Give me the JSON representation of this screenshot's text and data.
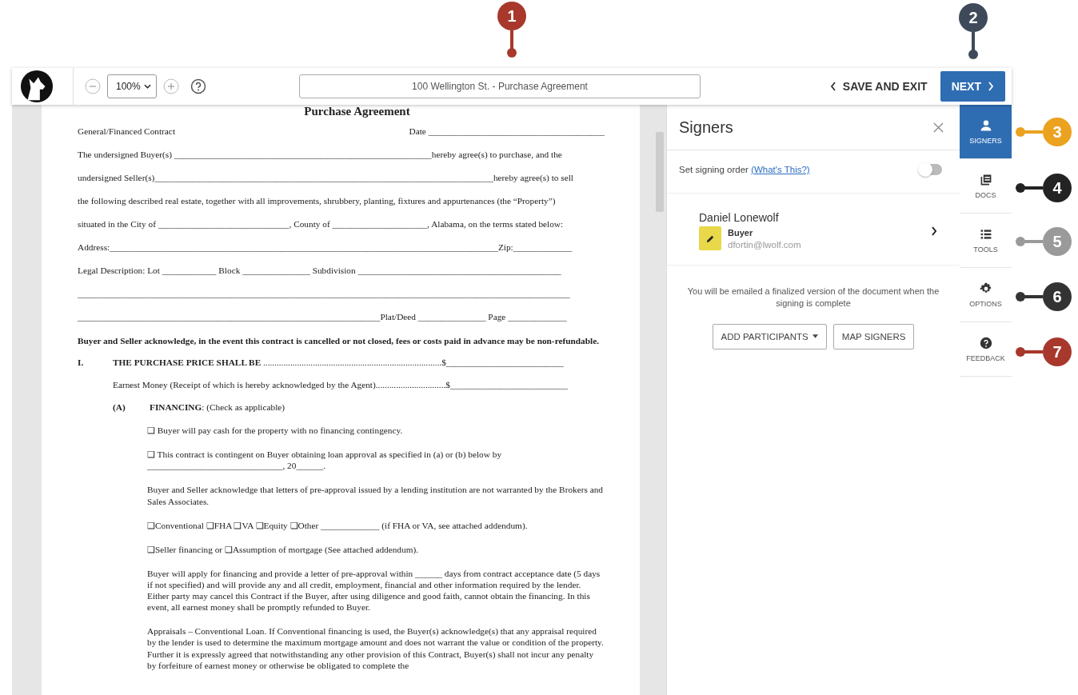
{
  "callouts": [
    {
      "number": "1",
      "color": "#a8372c",
      "kind": "down"
    },
    {
      "number": "2",
      "color": "#3e4a5a",
      "kind": "down"
    },
    {
      "number": "3",
      "color": "#eba21f",
      "kind": "left"
    },
    {
      "number": "4",
      "color": "#232323",
      "kind": "left"
    },
    {
      "number": "5",
      "color": "#9a9a9a",
      "kind": "left"
    },
    {
      "number": "6",
      "color": "#333333",
      "kind": "left"
    },
    {
      "number": "7",
      "color": "#a8372c",
      "kind": "left"
    }
  ],
  "toolbar": {
    "zoom": "100%",
    "document_title": "100 Wellington St. - Purchase Agreement",
    "save_exit": "SAVE AND EXIT",
    "next": "NEXT"
  },
  "document": {
    "title": "Purchase Agreement",
    "blocks": [
      {
        "kind": "line",
        "parts": [
          "General/Financed Contract",
          "Date _______________________________________"
        ]
      },
      {
        "kind": "line",
        "parts": [
          "The undersigned Buyer(s) _________________________________________________________hereby agree(s) to purchase, and the"
        ]
      },
      {
        "kind": "line",
        "parts": [
          "undersigned Seller(s)___________________________________________________________________________hereby agree(s) to sell"
        ]
      },
      {
        "kind": "line",
        "parts": [
          "the following described real estate, together with all improvements, shrubbery, planting, fixtures and appurtenances (the “Property”)"
        ]
      },
      {
        "kind": "line",
        "parts": [
          "situated in the City of _____________________________, County of _____________________, Alabama, on the terms stated below:"
        ]
      },
      {
        "kind": "line",
        "parts": [
          "Address:______________________________________________________________________________________Zip:_____________"
        ]
      },
      {
        "kind": "line",
        "parts": [
          "Legal Description: Lot ____________ Block _______________ Subdivision _____________________________________________"
        ]
      },
      {
        "kind": "line",
        "parts": [
          "_____________________________________________________________________________________________________________"
        ]
      },
      {
        "kind": "line",
        "parts": [
          "___________________________________________________________________Plat/Deed _______________ Page _____________"
        ]
      },
      {
        "kind": "bold",
        "text": "Buyer and Seller acknowledge, in the event this contract is cancelled or not closed, fees or costs paid in advance may be non-refundable."
      },
      {
        "kind": "numbered",
        "num": "I.",
        "text": "**THE PURCHASE PRICE SHALL BE** ...............................................................................$__________________________"
      },
      {
        "kind": "indent",
        "text": "Earnest Money (Receipt of which is hereby acknowledged by the Agent)...............................$__________________________"
      },
      {
        "kind": "lettered",
        "num": "(A)",
        "text": "**FINANCING**: (Check as applicable)"
      },
      {
        "kind": "para",
        "text": "❑ Buyer will pay cash for the property with no financing contingency."
      },
      {
        "kind": "para",
        "text": "❑ This contract is contingent on Buyer obtaining loan approval as specified in (a) or (b) below by ______________________________, 20______."
      },
      {
        "kind": "para",
        "text": "Buyer and Seller acknowledge that letters of pre-approval issued by a lending institution are not warranted by the Brokers and Sales Associates."
      },
      {
        "kind": "para",
        "text": "❑Conventional     ❑FHA     ❑VA     ❑Equity     ❑Other _____________     (if FHA or VA, see attached addendum)."
      },
      {
        "kind": "para",
        "text": "❑Seller financing or ❑Assumption of mortgage (See attached addendum)."
      },
      {
        "kind": "para",
        "text": "Buyer will apply for financing and provide a letter of pre-approval within ______ days from contract acceptance date (5 days if not specified) and will provide any and all credit, employment, financial and other information required by the lender. Either party may cancel this Contract if the Buyer, after using diligence and good faith, cannot obtain the financing. In this event, all earnest money shall be promptly refunded to Buyer."
      },
      {
        "kind": "para",
        "text": "Appraisals – Conventional Loan.  If Conventional financing is used, the Buyer(s) acknowledge(s) that any appraisal required by the lender is used to determine the maximum mortgage amount and does not warrant the value or condition of the property. Further it is expressly agreed that notwithstanding any other provision of this Contract, Buyer(s) shall not incur any penalty by forfeiture of earnest money or otherwise be obligated to complete the"
      }
    ]
  },
  "signers_panel": {
    "title": "Signers",
    "signing_order": {
      "label": "Set signing order",
      "link": "(What's This?)",
      "on": false
    },
    "signers": [
      {
        "name": "Daniel Lonewolf",
        "role": "Buyer",
        "email": "dfortin@lwolf.com"
      }
    ],
    "message": "You will be emailed a finalized version of the document when the signing is complete",
    "buttons": [
      {
        "label": "ADD PARTICIPANTS",
        "kind": "dropdown"
      },
      {
        "label": "MAP SIGNERS",
        "kind": "plain"
      }
    ]
  },
  "side_tabs": [
    {
      "label": "SIGNERS",
      "kind": "person",
      "selected": true
    },
    {
      "label": "DOCS",
      "kind": "docs",
      "selected": false
    },
    {
      "label": "TOOLS",
      "kind": "list",
      "selected": false
    },
    {
      "label": "OPTIONS",
      "kind": "gear",
      "selected": false
    },
    {
      "label": "FEEDBACK",
      "kind": "help",
      "selected": false
    }
  ]
}
